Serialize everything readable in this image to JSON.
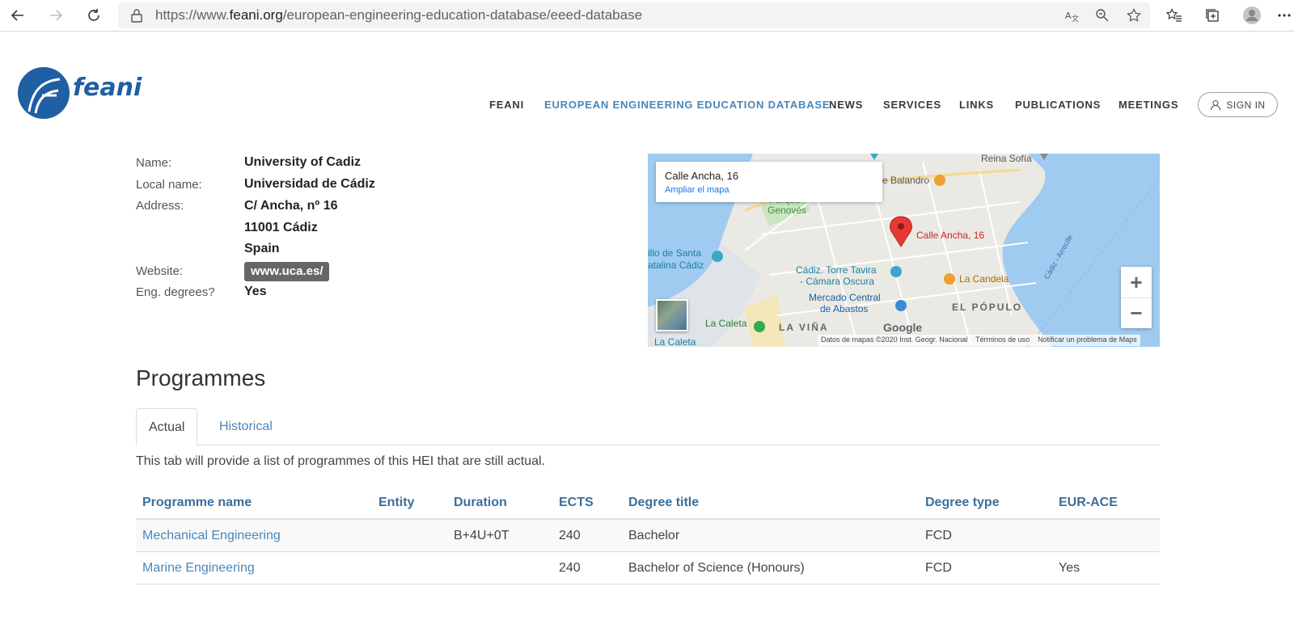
{
  "browser": {
    "url_scheme": "https://www.",
    "url_host": "feani.org",
    "url_path": "/european-engineering-education-database/eeed-database"
  },
  "header": {
    "logo_text": "feani",
    "nav": [
      {
        "label": "FEANI",
        "active": false
      },
      {
        "label": "EUROPEAN ENGINEERING EDUCATION DATABASE",
        "active": true
      },
      {
        "label": "NEWS",
        "active": false
      },
      {
        "label": "SERVICES",
        "active": false
      },
      {
        "label": "LINKS",
        "active": false
      },
      {
        "label": "PUBLICATIONS",
        "active": false
      },
      {
        "label": "MEETINGS",
        "active": false
      }
    ],
    "signin_label": "SIGN IN"
  },
  "info": {
    "name_label": "Name:",
    "name_value": "University of Cadiz",
    "local_label": "Local name:",
    "local_value": "Universidad de Cádiz",
    "address_label": "Address:",
    "address_line1": "C/ Ancha, nº 16",
    "address_line2": "11001 Cádiz",
    "address_line3": "Spain",
    "website_label": "Website:",
    "website_value": "www.uca.es/",
    "eng_label": "Eng. degrees?",
    "eng_value": "Yes"
  },
  "map": {
    "card_title": "Calle Ancha, 16",
    "card_link": "Ampliar el mapa",
    "pin_label": "Calle Ancha, 16",
    "labels": {
      "reina": "Reina Sofía",
      "balandro": "e Balandro",
      "genoves": "Genovés",
      "parque": "Parque",
      "santa": "illo de Santa",
      "catalina": "atalina Cádiz",
      "torre1": "Cádiz. Torre Tavira",
      "torre2": "- Cámara Oscura",
      "candela": "La Candela",
      "mercado1": "Mercado Central",
      "mercado2": "de Abastos",
      "populo": "EL PÓPULO",
      "caleta": "La Caleta",
      "vina": "LA VIÑA",
      "la_caleta": "La Caleta",
      "avenue": "Cádiz - Arrecife"
    },
    "google": "Google",
    "footer_data": "Datos de mapas ©2020 Inst. Geogr. Nacional",
    "footer_terms": "Términos de uso",
    "footer_report": "Notificar un problema de Maps",
    "zoom_in": "+",
    "zoom_out": "−"
  },
  "programmes": {
    "title": "Programmes",
    "tabs": [
      {
        "label": "Actual",
        "active": true
      },
      {
        "label": "Historical",
        "active": false
      }
    ],
    "tab_description": "This tab will provide a list of programmes of this HEI that are still actual.",
    "columns": [
      "Programme name",
      "Entity",
      "Duration",
      "ECTS",
      "Degree title",
      "Degree type",
      "EUR-ACE"
    ],
    "rows": [
      {
        "name": "Mechanical Engineering",
        "entity": "",
        "duration": "B+4U+0T",
        "ects": "240",
        "degree_title": "Bachelor",
        "degree_type": "FCD",
        "eur_ace": ""
      },
      {
        "name": "Marine Engineering",
        "entity": "",
        "duration": "",
        "ects": "240",
        "degree_title": "Bachelor of Science (Honours)",
        "degree_type": "FCD",
        "eur_ace": "Yes"
      }
    ]
  },
  "colors": {
    "accent": "#4a86b8",
    "header_blue": "#3b6f9c",
    "logo_blue": "#1f5fa3"
  }
}
